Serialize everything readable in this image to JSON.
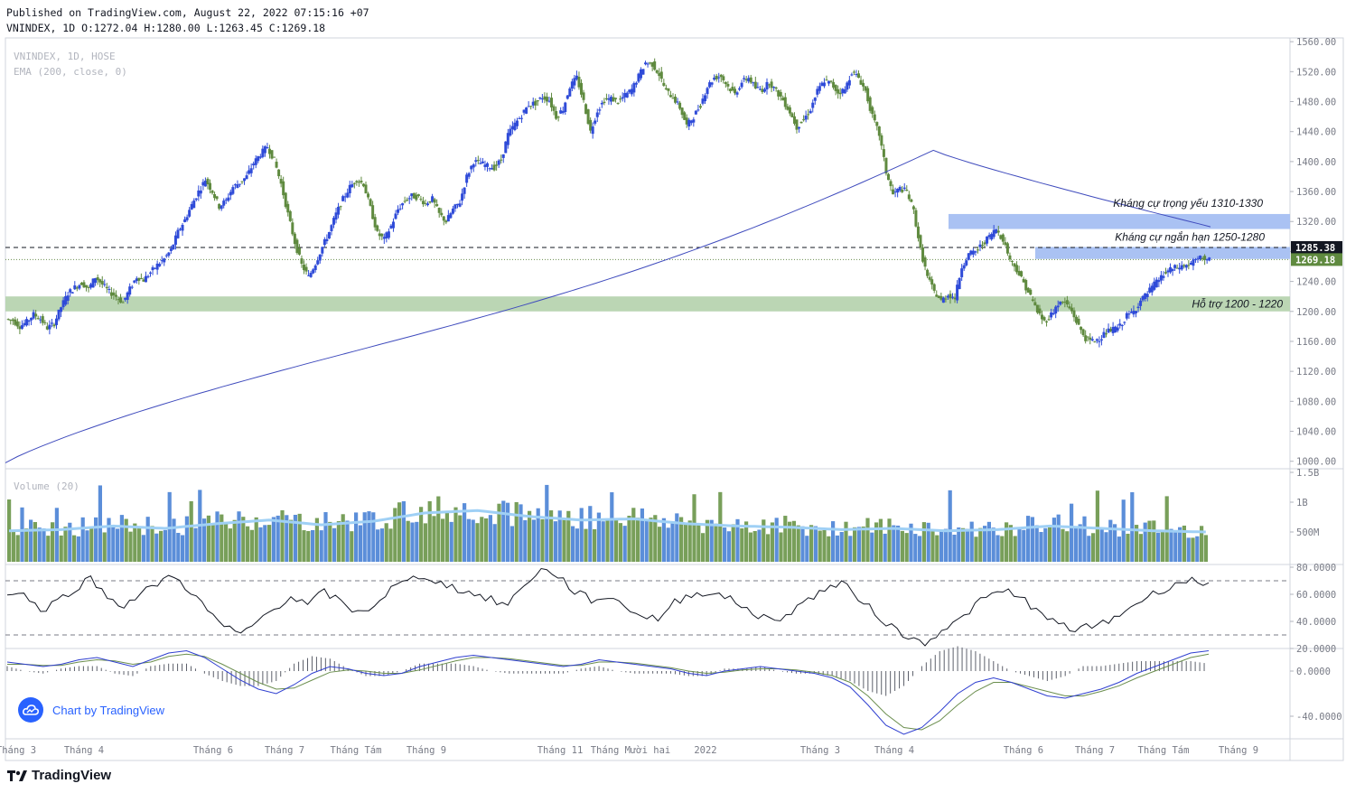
{
  "header": {
    "published": "Published on TradingView.com, August 22, 2022 07:15:16 +07",
    "ohlc": "VNINDEX, 1D O:1272.04 H:1280.00 L:1263.45 C:1269.18"
  },
  "legend": {
    "symbol": "VNINDEX, 1D, HOSE",
    "ema": "EMA (200, close, 0)",
    "volume": "Volume (20)"
  },
  "chart_data": [
    {
      "type": "candlestick",
      "symbol": "VNINDEX",
      "interval": "1D",
      "exchange": "HOSE",
      "ylim": [
        990,
        1565
      ],
      "y_ticks": [
        "1560.00",
        "1520.00",
        "1480.00",
        "1440.00",
        "1400.00",
        "1360.00",
        "1320.00",
        "1280.00",
        "1240.00",
        "1200.00",
        "1160.00",
        "1120.00",
        "1080.00",
        "1040.00",
        "1000.00"
      ],
      "x_ticks": [
        "Tháng 3",
        "Tháng 4",
        "Tháng 6",
        "Tháng 7",
        "Tháng Tám",
        "Tháng 9",
        "Tháng 11",
        "Tháng Mười hai",
        "2022",
        "Tháng 3",
        "Tháng 4",
        "Tháng 6",
        "Tháng 7",
        "Tháng Tám",
        "Tháng 9"
      ],
      "close_path": [
        1190,
        1188,
        1180,
        1186,
        1196,
        1190,
        1178,
        1184,
        1206,
        1224,
        1232,
        1238,
        1230,
        1246,
        1236,
        1226,
        1220,
        1212,
        1230,
        1246,
        1242,
        1252,
        1262,
        1270,
        1282,
        1306,
        1322,
        1342,
        1360,
        1376,
        1360,
        1340,
        1348,
        1366,
        1372,
        1380,
        1398,
        1410,
        1420,
        1402,
        1370,
        1330,
        1292,
        1262,
        1246,
        1264,
        1286,
        1306,
        1330,
        1350,
        1366,
        1376,
        1370,
        1338,
        1304,
        1296,
        1314,
        1336,
        1348,
        1354,
        1352,
        1344,
        1350,
        1330,
        1320,
        1336,
        1346,
        1380,
        1400,
        1398,
        1394,
        1392,
        1402,
        1436,
        1450,
        1462,
        1476,
        1478,
        1486,
        1482,
        1460,
        1470,
        1500,
        1512,
        1480,
        1440,
        1468,
        1482,
        1484,
        1480,
        1488,
        1496,
        1514,
        1532,
        1530,
        1516,
        1494,
        1486,
        1472,
        1448,
        1460,
        1476,
        1500,
        1512,
        1514,
        1500,
        1490,
        1506,
        1512,
        1498,
        1496,
        1506,
        1494,
        1482,
        1466,
        1446,
        1456,
        1470,
        1494,
        1508,
        1504,
        1492,
        1496,
        1520,
        1512,
        1494,
        1460,
        1436,
        1386,
        1356,
        1364,
        1360,
        1334,
        1282,
        1246,
        1226,
        1214,
        1222,
        1218,
        1260,
        1276,
        1280,
        1290,
        1300,
        1310,
        1296,
        1270,
        1256,
        1238,
        1220,
        1200,
        1186,
        1196,
        1210,
        1212,
        1200,
        1180,
        1164,
        1160,
        1164,
        1172,
        1176,
        1180,
        1194,
        1200,
        1214,
        1224,
        1236,
        1246,
        1254,
        1258,
        1260,
        1262,
        1268,
        1272,
        1269
      ],
      "ema_200": {
        "start": 998,
        "end": 1313,
        "peak": 1415
      },
      "levels": {
        "prev_close": 1285.38,
        "last": 1269.18
      },
      "zones": [
        {
          "label": "Kháng cự trọng yếu 1310-1330",
          "low": 1310,
          "high": 1330,
          "color": "#a5bff2"
        },
        {
          "label": "Kháng cự ngắn hạn 1250-1280",
          "low": 1270,
          "high": 1286,
          "color": "#a5bff2"
        },
        {
          "label": "Hỗ trợ 1200 - 1220",
          "low": 1200,
          "high": 1220,
          "color": "#b7d4b0"
        }
      ],
      "price_badges": [
        "1285.38",
        "1269.18"
      ]
    },
    {
      "type": "bar",
      "name": "Volume",
      "y_ticks": [
        "1.5B",
        "1B",
        "500M"
      ],
      "ylim": [
        0,
        1500000000
      ],
      "values_avg_m": [
        520,
        540,
        600,
        560,
        640,
        700,
        620,
        680,
        820,
        860,
        760,
        700,
        720,
        640,
        600,
        580,
        540,
        560,
        520,
        540,
        600,
        560,
        520,
        500
      ],
      "ma20": true,
      "colors": {
        "up": "#789f5a",
        "down": "#5b8ed9",
        "ma": "#9fd0f5"
      }
    },
    {
      "type": "line",
      "name": "RSI",
      "y_ticks": [
        "80.0000",
        "60.0000",
        "40.0000",
        "20.0000"
      ],
      "ylim": [
        20,
        82
      ],
      "bands": [
        70,
        30
      ],
      "values": [
        62,
        60,
        48,
        55,
        64,
        72,
        58,
        52,
        60,
        68,
        74,
        62,
        48,
        36,
        30,
        40,
        50,
        58,
        52,
        62,
        54,
        46,
        52,
        64,
        70,
        74,
        68,
        64,
        60,
        56,
        52,
        68,
        78,
        74,
        62,
        56,
        58,
        52,
        44,
        42,
        54,
        60,
        62,
        58,
        52,
        44,
        40,
        48,
        56,
        64,
        68,
        58,
        46,
        36,
        28,
        24,
        34,
        40,
        52,
        60,
        62,
        56,
        44,
        38,
        34,
        36,
        40,
        48,
        56,
        62,
        68,
        70,
        68
      ]
    },
    {
      "type": "line",
      "name": "MACD",
      "y_ticks": [
        "0.0000",
        "-40.0000"
      ],
      "ylim": [
        -60,
        20
      ],
      "macd": [
        8,
        6,
        4,
        6,
        10,
        12,
        8,
        4,
        10,
        16,
        18,
        12,
        2,
        -8,
        -16,
        -20,
        -12,
        -2,
        4,
        2,
        -2,
        -4,
        -2,
        4,
        8,
        12,
        14,
        12,
        10,
        8,
        6,
        4,
        6,
        10,
        8,
        6,
        4,
        2,
        -2,
        -4,
        0,
        2,
        4,
        2,
        0,
        -2,
        -6,
        -14,
        -30,
        -48,
        -56,
        -50,
        -36,
        -20,
        -10,
        -6,
        -10,
        -16,
        -22,
        -24,
        -20,
        -16,
        -10,
        -2,
        4,
        10,
        16,
        18
      ],
      "signal": [
        6,
        6,
        5,
        5,
        8,
        10,
        9,
        6,
        8,
        13,
        15,
        13,
        6,
        -2,
        -10,
        -16,
        -15,
        -8,
        -1,
        1,
        0,
        -2,
        -2,
        1,
        5,
        9,
        12,
        12,
        11,
        9,
        7,
        5,
        5,
        8,
        8,
        7,
        5,
        3,
        0,
        -2,
        -1,
        1,
        2,
        2,
        1,
        -1,
        -4,
        -10,
        -22,
        -38,
        -50,
        -52,
        -44,
        -30,
        -18,
        -10,
        -10,
        -14,
        -18,
        -22,
        -22,
        -18,
        -13,
        -6,
        0,
        6,
        12,
        15
      ]
    }
  ],
  "watermark": "Chart by TradingView",
  "footer": "TradingView"
}
